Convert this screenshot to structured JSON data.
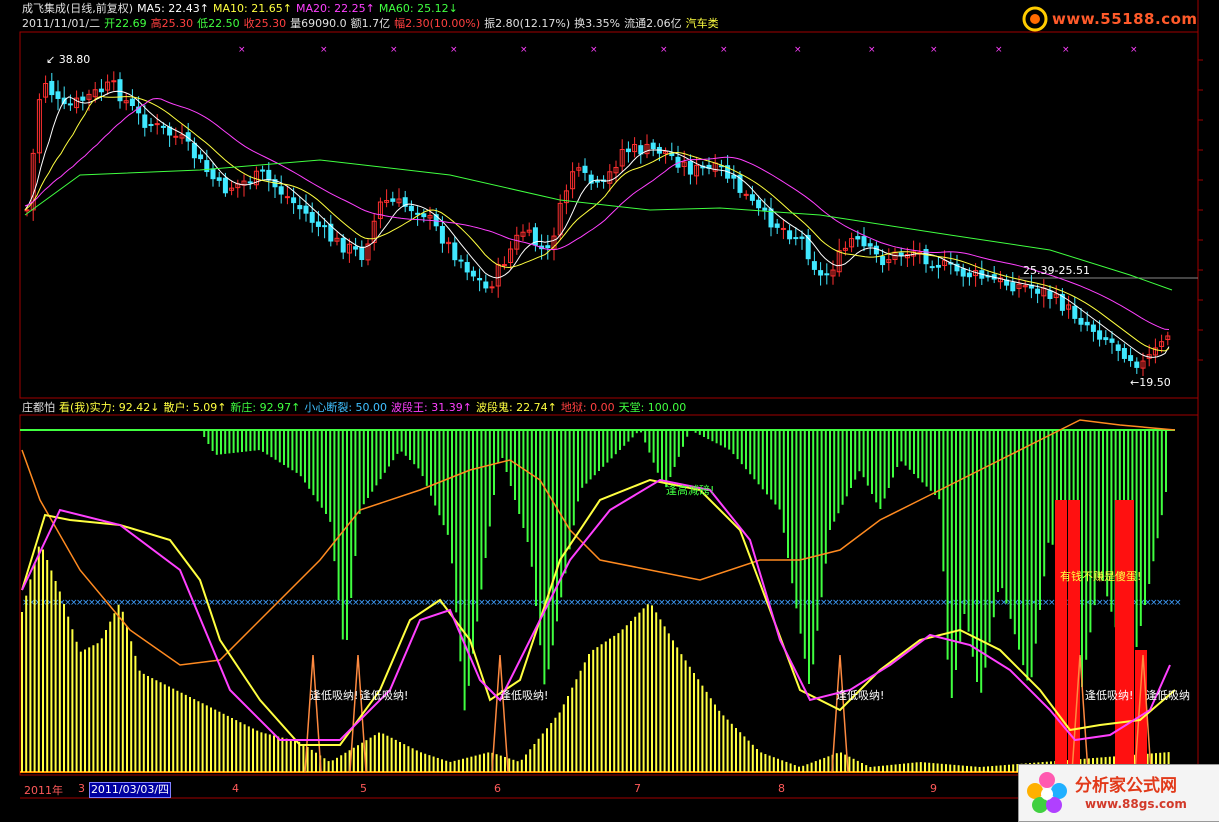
{
  "header": {
    "row1": [
      {
        "text": "成飞集成(日线,前复权)",
        "color": "#e0e0e0"
      },
      {
        "text": "MA5: 22.43↑",
        "color": "#ffffff"
      },
      {
        "text": "MA10: 21.65↑",
        "color": "#ffff40"
      },
      {
        "text": "MA20: 22.25↑",
        "color": "#ff40ff"
      },
      {
        "text": "MA60: 25.12↓",
        "color": "#40ff40"
      }
    ],
    "row2": [
      {
        "text": "2011/11/01/二",
        "color": "#e0e0e0"
      },
      {
        "text": "开22.69",
        "color": "#40ff40"
      },
      {
        "text": "高25.30",
        "color": "#ff4040"
      },
      {
        "text": "低22.50",
        "color": "#40ff40"
      },
      {
        "text": "收25.30",
        "color": "#ff4040"
      },
      {
        "text": "量69090.0",
        "color": "#e0e0e0"
      },
      {
        "text": "额1.7亿",
        "color": "#e0e0e0"
      },
      {
        "text": "幅2.30(10.00%)",
        "color": "#ff4040"
      },
      {
        "text": "振2.80(12.17%)",
        "color": "#e0e0e0"
      },
      {
        "text": "换3.35%",
        "color": "#e0e0e0"
      },
      {
        "text": "流通2.06亿",
        "color": "#e0e0e0"
      },
      {
        "text": "汽车类",
        "color": "#ffff40"
      }
    ]
  },
  "indicator_row": [
    {
      "text": "庄都怕",
      "color": "#e0e0e0"
    },
    {
      "text": "看(我)实力: 92.42↓",
      "color": "#ffff40"
    },
    {
      "text": "散户: 5.09↑",
      "color": "#ffff40"
    },
    {
      "text": "新庄: 92.97↑",
      "color": "#40ff40"
    },
    {
      "text": "小心断裂: 50.00",
      "color": "#40c0ff"
    },
    {
      "text": "波段王: 31.39↑",
      "color": "#ff40ff"
    },
    {
      "text": "波段鬼: 22.74↑",
      "color": "#ffff40"
    },
    {
      "text": "地狱: 0.00",
      "color": "#ff4040"
    },
    {
      "text": "天堂: 100.00",
      "color": "#40ff40"
    }
  ],
  "price_labels": {
    "high": "38.80",
    "low": "19.50",
    "range": "25.39-25.51"
  },
  "annotations": [
    {
      "text": "逢低吸纳!",
      "color": "#ffffff"
    },
    {
      "text": "逢低吸纳!",
      "color": "#ffffff"
    },
    {
      "text": "逢低吸纳!",
      "color": "#ffffff"
    },
    {
      "text": "逢低吸纳!",
      "color": "#ffffff"
    },
    {
      "text": "逢低吸纳!",
      "color": "#ffffff"
    },
    {
      "text": "逢低吸纳",
      "color": "#ffffff"
    },
    {
      "text": "逢高减磅!",
      "color": "#40ff40"
    },
    {
      "text": "有钱不赚是傻蛋!",
      "color": "#ffff40"
    }
  ],
  "time_axis": {
    "year": "2011年",
    "labels": [
      "3",
      "4",
      "5",
      "6",
      "7",
      "8",
      "9"
    ],
    "cursor_date": "2011/03/03/四"
  },
  "watermark_top": "www.55188.com",
  "watermark_bottom": {
    "title": "分析家公式网",
    "url": "www.88gs.com"
  },
  "colors": {
    "up": "#ff3030",
    "down": "#40e8ff",
    "ma5": "#ffffff",
    "ma10": "#ffff40",
    "ma20": "#ff40ff",
    "ma60": "#40ff40"
  }
}
